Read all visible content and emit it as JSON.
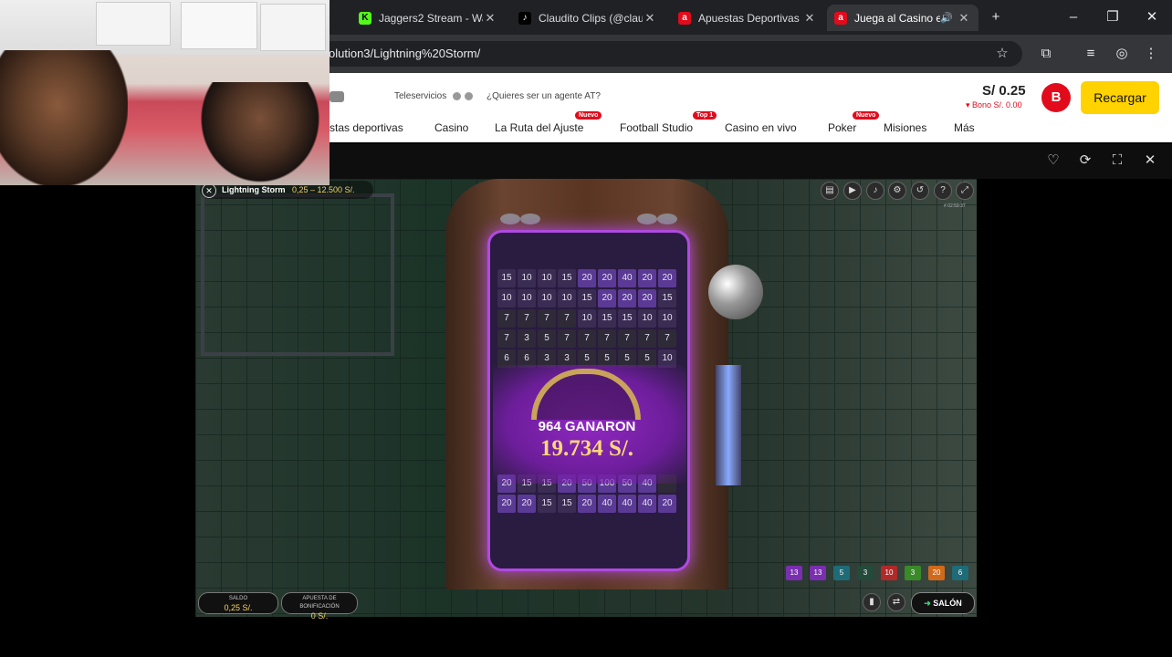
{
  "browser": {
    "tabs": [
      {
        "title": "Jaggers2 Stream - Wa",
        "favicon": "K",
        "favicon_color": "#53fc18"
      },
      {
        "title": "Claudito Clips (@clau",
        "favicon": "♪",
        "favicon_color": "#ffffff"
      },
      {
        "title": "Apuestas Deportivas",
        "favicon": "a",
        "favicon_color": "#e10b1c"
      },
      {
        "title": "Juega al Casino e",
        "favicon": "a",
        "favicon_color": "#e10b1c",
        "active": true
      }
    ],
    "new_tab": "+",
    "url": "olution3/Lightning%20Storm/"
  },
  "site": {
    "top_links": [
      "Teleservicios",
      "¿Quieres ser un agente AT?"
    ],
    "balance": "S/ 0.25",
    "bonus": "Bono S/. 0.00",
    "avatar_letter": "B",
    "recharge": "Recargar",
    "nav": [
      {
        "label": "stas deportivas"
      },
      {
        "label": "Casino"
      },
      {
        "label": "La Ruta del Ajuste",
        "badge": "Nuevo"
      },
      {
        "label": "Football Studio",
        "badge": "Top 1"
      },
      {
        "label": "Casino en vivo"
      },
      {
        "label": "Poker",
        "badge": "Nuevo"
      },
      {
        "label": "Misiones"
      },
      {
        "label": "Más"
      }
    ],
    "accent": "#e10b1c",
    "recharge_color": "#ffd200"
  },
  "game": {
    "title": "Lightning Storm",
    "limits": "0,25 – 12.500 S/.",
    "board": [
      [
        "15",
        "10",
        "10",
        "15",
        "20",
        "20",
        "40",
        "20",
        "20"
      ],
      [
        "10",
        "10",
        "10",
        "10",
        "15",
        "20",
        "20",
        "20",
        "15"
      ],
      [
        "7",
        "7",
        "7",
        "7",
        "10",
        "15",
        "15",
        "10",
        "10"
      ],
      [
        "7",
        "3",
        "5",
        "7",
        "7",
        "7",
        "7",
        "7",
        "7"
      ],
      [
        "6",
        "6",
        "3",
        "3",
        "5",
        "5",
        "5",
        "5",
        "10"
      ],
      [
        "20",
        "15",
        "15",
        "20",
        "50",
        "100",
        "50",
        "40",
        ""
      ],
      [
        "20",
        "20",
        "15",
        "15",
        "20",
        "40",
        "40",
        "40",
        "20"
      ]
    ],
    "winners": "964 GANARON",
    "win_amount": "19.734 S/.",
    "history": [
      "13",
      "13",
      "5",
      "3",
      "10",
      "3",
      "20",
      "6"
    ],
    "saldo_label": "SALDO",
    "saldo": "0,25 S/.",
    "bonus_label": "APUESTA DE BONIFICACIÓN",
    "bonus_bet": "0 S/.",
    "lobby": "SALÓN",
    "timer": "# 02:59:37"
  }
}
